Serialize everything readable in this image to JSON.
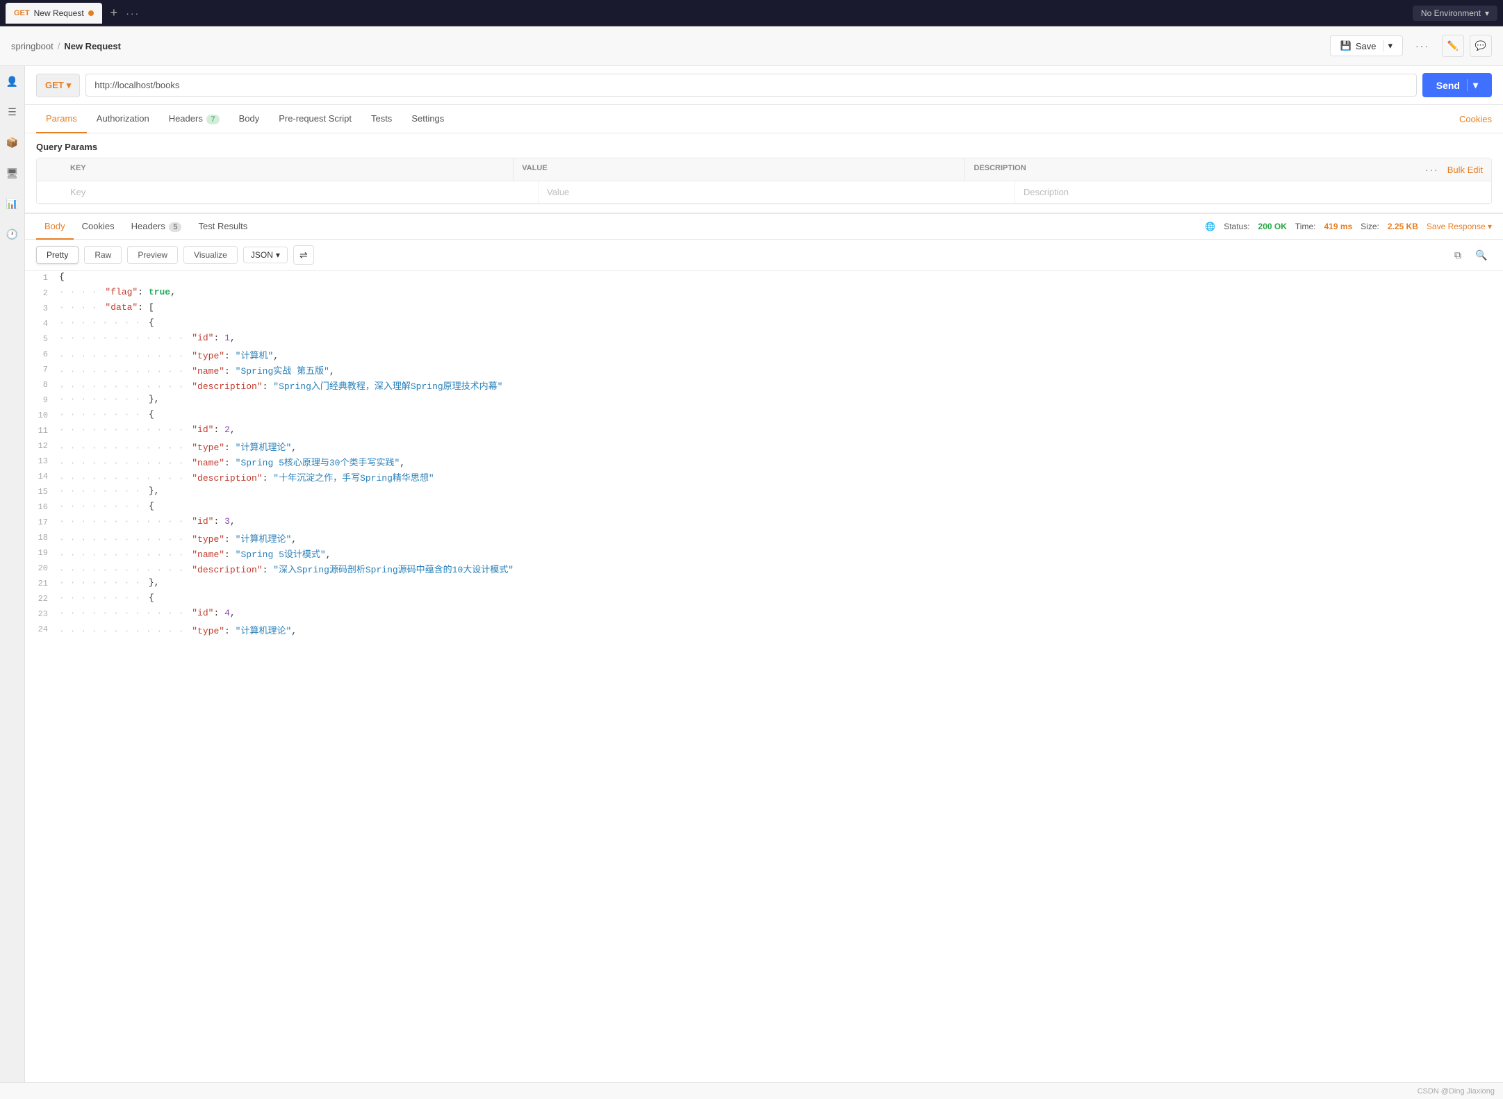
{
  "tabBar": {
    "method": "GET",
    "title": "New Request",
    "dot_color": "#e67e22",
    "add_icon": "+",
    "more_dots": "···",
    "env_label": "No Environment",
    "chevron": "▾"
  },
  "headerBar": {
    "breadcrumb_collection": "springboot",
    "breadcrumb_separator": "/",
    "breadcrumb_current": "New Request",
    "save_label": "Save",
    "more_dots": "···",
    "edit_icon": "✏",
    "comment_icon": "💬"
  },
  "urlBar": {
    "method": "GET",
    "chevron": "▾",
    "url": "http://localhost/books",
    "send_label": "Send",
    "send_chevron": "▾"
  },
  "requestTabs": {
    "tabs": [
      {
        "label": "Params",
        "badge": null,
        "active": true
      },
      {
        "label": "Authorization",
        "badge": null,
        "active": false
      },
      {
        "label": "Headers",
        "badge": "7",
        "active": false
      },
      {
        "label": "Body",
        "badge": null,
        "active": false
      },
      {
        "label": "Pre-request Script",
        "badge": null,
        "active": false
      },
      {
        "label": "Tests",
        "badge": null,
        "active": false
      },
      {
        "label": "Settings",
        "badge": null,
        "active": false
      }
    ],
    "cookies_link": "Cookies"
  },
  "queryParams": {
    "section_title": "Query Params",
    "columns": [
      "KEY",
      "VALUE",
      "DESCRIPTION"
    ],
    "more_dots": "···",
    "bulk_edit_label": "Bulk Edit",
    "placeholder_key": "Key",
    "placeholder_value": "Value",
    "placeholder_desc": "Description"
  },
  "responseTabs": {
    "tabs": [
      {
        "label": "Body",
        "badge": null,
        "active": true
      },
      {
        "label": "Cookies",
        "badge": null,
        "active": false
      },
      {
        "label": "Headers",
        "badge": "5",
        "active": false
      },
      {
        "label": "Test Results",
        "badge": null,
        "active": false
      }
    ],
    "status_label": "Status:",
    "status_value": "200 OK",
    "time_label": "Time:",
    "time_value": "419 ms",
    "size_label": "Size:",
    "size_value": "2.25 KB",
    "save_response_label": "Save Response",
    "chevron": "▾"
  },
  "responseToolbar": {
    "views": [
      "Pretty",
      "Raw",
      "Preview",
      "Visualize"
    ],
    "active_view": "Pretty",
    "format": "JSON",
    "format_chevron": "▾",
    "wrap_icon": "≡→"
  },
  "jsonContent": {
    "lines": [
      {
        "num": 1,
        "indent": 0,
        "content": "{",
        "type": "brace"
      },
      {
        "num": 2,
        "indent": 1,
        "key": "flag",
        "value": "true",
        "value_type": "bool",
        "comma": ","
      },
      {
        "num": 3,
        "indent": 1,
        "key": "data",
        "value": "[",
        "value_type": "brace",
        "comma": ""
      },
      {
        "num": 4,
        "indent": 2,
        "content": "{",
        "type": "brace"
      },
      {
        "num": 5,
        "indent": 3,
        "key": "id",
        "value": "1",
        "value_type": "num",
        "comma": ","
      },
      {
        "num": 6,
        "indent": 3,
        "key": "type",
        "value": "\"计算机\"",
        "value_type": "str",
        "comma": ","
      },
      {
        "num": 7,
        "indent": 3,
        "key": "name",
        "value": "\"Spring实战 第五版\"",
        "value_type": "str",
        "comma": ","
      },
      {
        "num": 8,
        "indent": 3,
        "key": "description",
        "value": "\"Spring入门经典教程，深入理解Spring原理技术内幕\"",
        "value_type": "str",
        "comma": ""
      },
      {
        "num": 9,
        "indent": 2,
        "content": "},",
        "type": "brace"
      },
      {
        "num": 10,
        "indent": 2,
        "content": "{",
        "type": "brace"
      },
      {
        "num": 11,
        "indent": 3,
        "key": "id",
        "value": "2",
        "value_type": "num",
        "comma": ","
      },
      {
        "num": 12,
        "indent": 3,
        "key": "type",
        "value": "\"计算机理论\"",
        "value_type": "str",
        "comma": ","
      },
      {
        "num": 13,
        "indent": 3,
        "key": "name",
        "value": "\"Spring 5核心原理与30个类手写实践\"",
        "value_type": "str",
        "comma": ","
      },
      {
        "num": 14,
        "indent": 3,
        "key": "description",
        "value": "\"十年沉淀之作，手写Spring精华思想\"",
        "value_type": "str",
        "comma": ""
      },
      {
        "num": 15,
        "indent": 2,
        "content": "},",
        "type": "brace"
      },
      {
        "num": 16,
        "indent": 2,
        "content": "{",
        "type": "brace"
      },
      {
        "num": 17,
        "indent": 3,
        "key": "id",
        "value": "3",
        "value_type": "num",
        "comma": ","
      },
      {
        "num": 18,
        "indent": 3,
        "key": "type",
        "value": "\"计算机理论\"",
        "value_type": "str",
        "comma": ","
      },
      {
        "num": 19,
        "indent": 3,
        "key": "name",
        "value": "\"Spring 5设计模式\"",
        "value_type": "str",
        "comma": ","
      },
      {
        "num": 20,
        "indent": 3,
        "key": "description",
        "value": "\"深入Spring源码剖析Spring源码中蕴含的10大设计模式\"",
        "value_type": "str",
        "comma": ""
      },
      {
        "num": 21,
        "indent": 2,
        "content": "},",
        "type": "brace"
      },
      {
        "num": 22,
        "indent": 2,
        "content": "{",
        "type": "brace"
      },
      {
        "num": 23,
        "indent": 3,
        "key": "id",
        "value": "4",
        "value_type": "num",
        "comma": ","
      },
      {
        "num": 24,
        "indent": 3,
        "key": "type",
        "value": "\"计算机理论\"",
        "value_type": "str",
        "comma": ","
      }
    ]
  },
  "footer": {
    "credit": "CSDN @Ding Jiaxiong"
  }
}
